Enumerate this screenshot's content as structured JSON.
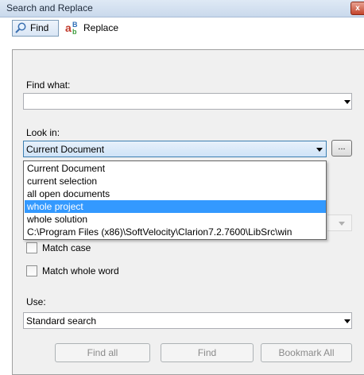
{
  "window": {
    "title": "Search and Replace",
    "close_glyph": "x"
  },
  "tabs": [
    {
      "label": "Find",
      "icon": "magnifier-icon",
      "active": true
    },
    {
      "label": "Replace",
      "icon": "replace-icon",
      "active": false
    }
  ],
  "find_what": {
    "label": "Find what:",
    "value": ""
  },
  "look_in": {
    "label": "Look in:",
    "selected": "Current Document",
    "browse_label": "...",
    "options": [
      "Current Document",
      "current selection",
      "all open documents",
      "whole project",
      "whole solution",
      "C:\\Program Files (x86)\\SoftVelocity\\Clarion7.2.7600\\LibSrc\\win"
    ],
    "highlighted_option": "whole project"
  },
  "options": {
    "match_case": {
      "label": "Match case",
      "checked": false
    },
    "match_whole_word": {
      "label": "Match whole word",
      "checked": false
    }
  },
  "use": {
    "label": "Use:",
    "selected": "Standard search"
  },
  "buttons": {
    "find_all": "Find all",
    "find": "Find",
    "bookmark_all": "Bookmark All"
  },
  "colors": {
    "selection": "#3399ff",
    "title_bar": "#dfe9f5",
    "panel": "#f0f0f0"
  }
}
